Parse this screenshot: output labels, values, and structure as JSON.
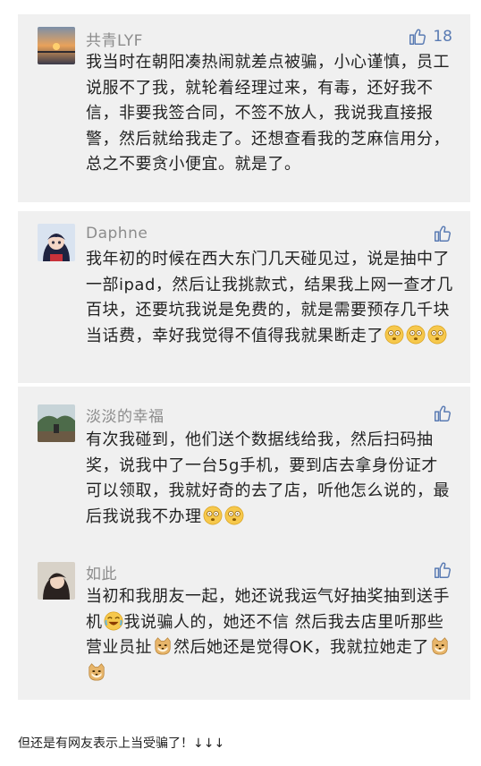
{
  "comments": [
    {
      "name": "共青LYF",
      "likes": "18",
      "text": "我当时在朝阳凑热闹就差点被骗，小心谨慎，员工说服不了我，就轮着经理过来，有毒，还好我不信，非要我签合同，不签不放人，我说我直接报警，然后就给我走了。还想查看我的芝麻信用分，总之不要贪小便宜。就是了。",
      "avatar_icon": "sunset-avatar"
    },
    {
      "name": "Daphne",
      "text": "我年初的时候在西大东门几天碰见过，说是抽中了一部ipad，然后让我挑款式，结果我上网一查才几百块，还要坑我说是免费的，就是需要预存几千块当话费，幸好我觉得不值得我就果断走了",
      "avatar_icon": "anime-girl-avatar"
    },
    {
      "name": "淡淡的幸福",
      "text": "有次我碰到，他们送个数据线给我，然后扫码抽奖，说我中了一台5g手机，要到店去拿身份证才可以领取，我就好奇的去了店，听他怎么说的，最后我说我不办理",
      "avatar_icon": "landscape-avatar"
    },
    {
      "name": "如此",
      "text_a": "当初和我朋友一起，她还说我运气好抽奖抽到送手机",
      "text_b": "我说骗人的，她还不信 然后我去店里听那些营业员扯",
      "text_c": "然后她还是觉得OK，我就拉她走了",
      "avatar_icon": "woman-avatar"
    }
  ],
  "footer_text": "但还是有网友表示上当受骗了！↓↓↓",
  "colors": {
    "card_bg": "#f0f0f0",
    "name": "#8c8c8c",
    "like": "#5a7bb3",
    "text": "#222222"
  }
}
